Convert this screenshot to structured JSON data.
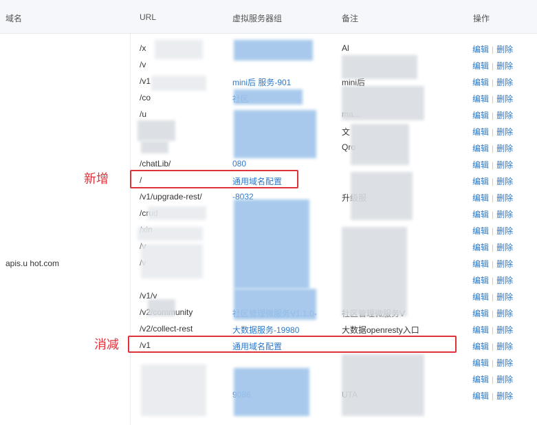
{
  "header": {
    "domain": "域名",
    "url": "URL",
    "group": "虚拟服务器组",
    "remark": "备注",
    "ops": "操作"
  },
  "domain": "apis.u     hot.com",
  "ops": {
    "edit": "编辑",
    "delete": "删除"
  },
  "rows": [
    {
      "url": "/x",
      "group": "",
      "remark": "Al"
    },
    {
      "url": "/v",
      "group": "",
      "remark": ""
    },
    {
      "url": "/v1",
      "group": "mini后     服务-901",
      "remark": "mini后"
    },
    {
      "url": "/co",
      "group": "社区",
      "remark": ""
    },
    {
      "url": "/u",
      "group": "",
      "remark": "ma..."
    },
    {
      "url": "",
      "group": "",
      "remark": "文"
    },
    {
      "url": "",
      "group": "",
      "remark": "Qro"
    },
    {
      "url": "/chatLib/",
      "group": "080",
      "remark": ""
    },
    {
      "url": "/",
      "group": "通用域名配置",
      "remark": ""
    },
    {
      "url": "/v1/upgrade-rest/",
      "group": "-8032",
      "remark": "升级服"
    },
    {
      "url": "/crud",
      "group": "",
      "remark": ""
    },
    {
      "url": "/xin",
      "group": "",
      "remark": ""
    },
    {
      "url": "/v",
      "group": "",
      "remark": ""
    },
    {
      "url": "/v",
      "group": "",
      "remark": ""
    },
    {
      "url": "",
      "group": "",
      "remark": ""
    },
    {
      "url": "/v1/v",
      "group": "",
      "remark": ""
    },
    {
      "url": "/v2/community",
      "group": "社区管理微服务V1.1.0-",
      "remark": "社区管理微服务V"
    },
    {
      "url": "/v2/collect-rest",
      "group": "大数据服务-19980",
      "remark": "大数据openresty入口"
    },
    {
      "url": "/v1",
      "group": "通用域名配置",
      "remark": ""
    },
    {
      "url": "",
      "group": "",
      "remark": ""
    },
    {
      "url": "",
      "group": "",
      "remark": ""
    },
    {
      "url": "",
      "group": "9086",
      "remark": "UTA"
    }
  ],
  "annotations": {
    "added": "新增",
    "removed": "消减"
  }
}
